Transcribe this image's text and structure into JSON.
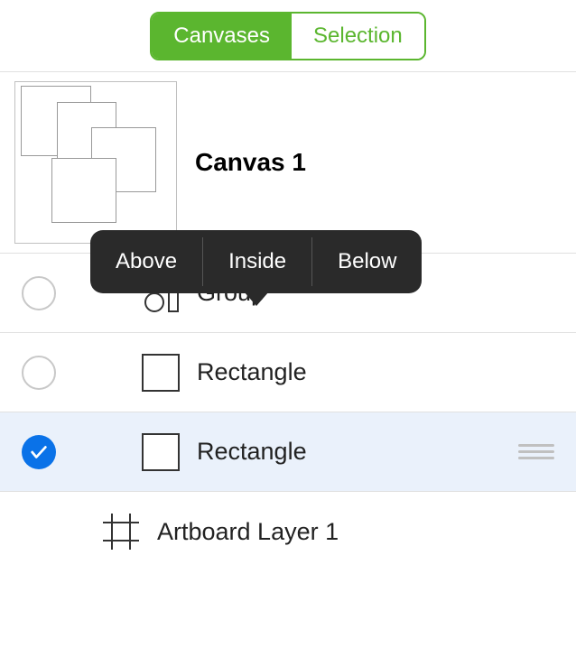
{
  "tabs": {
    "canvases": "Canvases",
    "selection": "Selection"
  },
  "canvas": {
    "title": "Canvas 1"
  },
  "popover": {
    "above": "Above",
    "inside": "Inside",
    "below": "Below"
  },
  "layers": {
    "group": "Group",
    "rectangle1": "Rectangle",
    "rectangle2": "Rectangle",
    "artboard": "Artboard Layer 1"
  }
}
